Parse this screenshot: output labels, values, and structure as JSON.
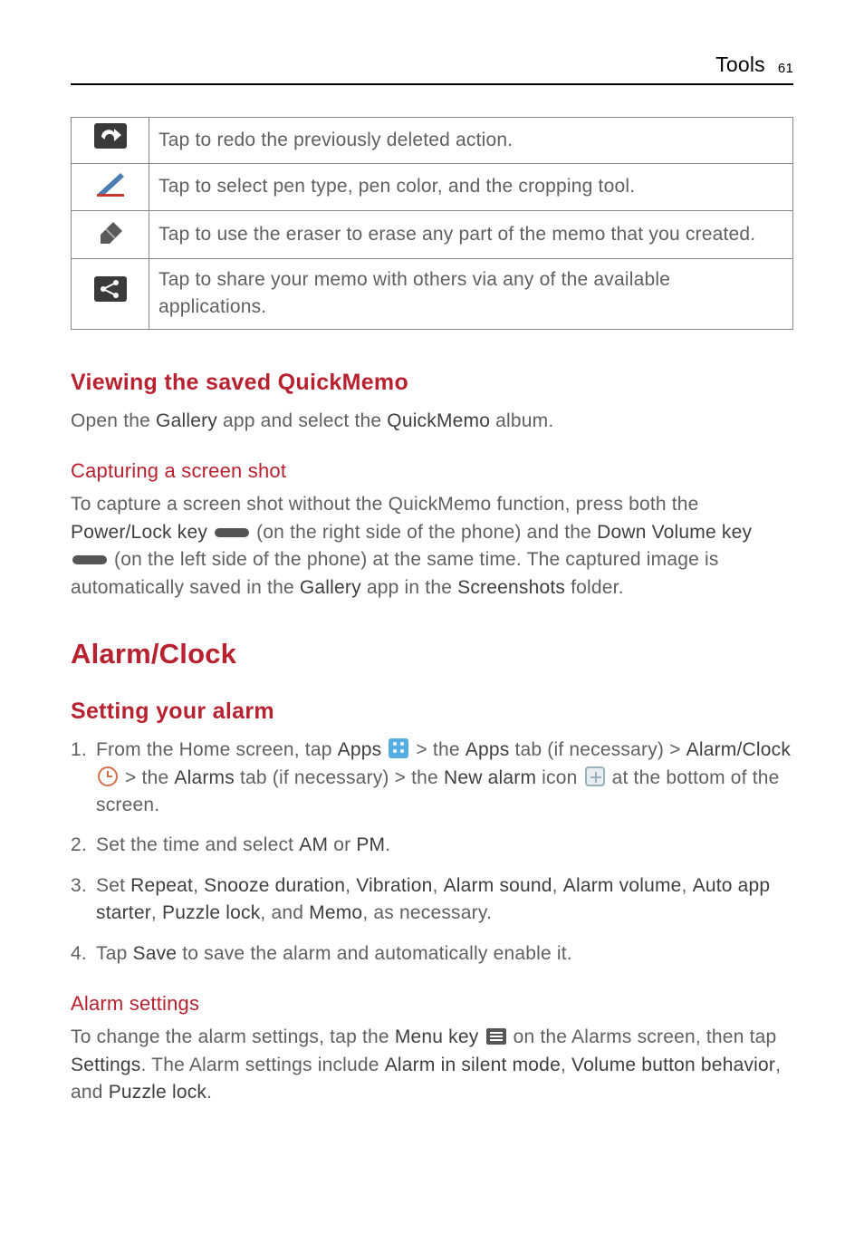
{
  "header": {
    "section": "Tools",
    "page": "61"
  },
  "table": {
    "rows": [
      {
        "icon": "redo-icon",
        "desc": "Tap to redo the previously deleted action."
      },
      {
        "icon": "pen-icon",
        "desc": "Tap to select pen type, pen color, and the cropping tool."
      },
      {
        "icon": "eraser-icon",
        "desc": "Tap to use the eraser to erase any part of the memo that you created."
      },
      {
        "icon": "share-icon",
        "desc": "Tap to share your memo with others via any of the available applications."
      }
    ]
  },
  "section1": {
    "heading": "Viewing the saved QuickMemo",
    "p_parts": [
      "Open the ",
      "Gallery",
      " app and select the ",
      "QuickMemo",
      " album."
    ]
  },
  "section2": {
    "heading": "Capturing a screen shot",
    "p_parts_a": [
      "To capture a screen shot without the QuickMemo function, press both the ",
      "Power/Lock key"
    ],
    "p_mid1": " (on the right side of the phone) and the ",
    "p_bold2": "Down Volume key",
    "p_mid2": " (on the left side of the phone) at the same time. The captured image is automatically saved in the ",
    "p_bold3": "Gallery",
    "p_mid3": " app in the ",
    "p_bold4": "Screenshots",
    "p_end": " folder."
  },
  "section3": {
    "main_heading": "Alarm/Clock",
    "sub_heading": "Setting your alarm",
    "steps": {
      "s1": {
        "t1": "From the Home screen, tap ",
        "b1": "Apps",
        "t2": " > the ",
        "b2": "Apps",
        "t3": " tab (if necessary) > ",
        "b3": "Alarm/Clock",
        "t4": " > the ",
        "b4": "Alarms",
        "t5": " tab (if necessary) > the ",
        "b5": "New alarm",
        "t6": " icon ",
        "t7": " at the bottom of the screen."
      },
      "s2": {
        "t1": "Set the time and select ",
        "b1": "AM",
        "t2": " or ",
        "b2": "PM",
        "t3": "."
      },
      "s3": {
        "t1": "Set ",
        "b1": "Repeat",
        "c1": ", ",
        "b2": "Snooze duration",
        "c2": ", ",
        "b3": "Vibration",
        "c3": ", ",
        "b4": "Alarm sound",
        "c4": ", ",
        "b5": "Alarm volume",
        "c5": ", ",
        "b6": "Auto app starter",
        "c6": ", ",
        "b7": "Puzzle lock",
        "c7": ", and ",
        "b8": "Memo",
        "t2": ", as necessary."
      },
      "s4": {
        "t1": "Tap ",
        "b1": "Save",
        "t2": " to save the alarm and automatically enable it."
      }
    }
  },
  "section4": {
    "heading": "Alarm settings",
    "t1": "To change the alarm settings, tap the ",
    "b1": "Menu key",
    "t2": " on the Alarms screen, then tap ",
    "b2": "Settings",
    "t3": ". The Alarm settings include ",
    "b3": "Alarm in silent mode",
    "c1": ", ",
    "b4": "Volume button behavior",
    "c2": ", and ",
    "b5": "Puzzle lock",
    "t4": "."
  }
}
